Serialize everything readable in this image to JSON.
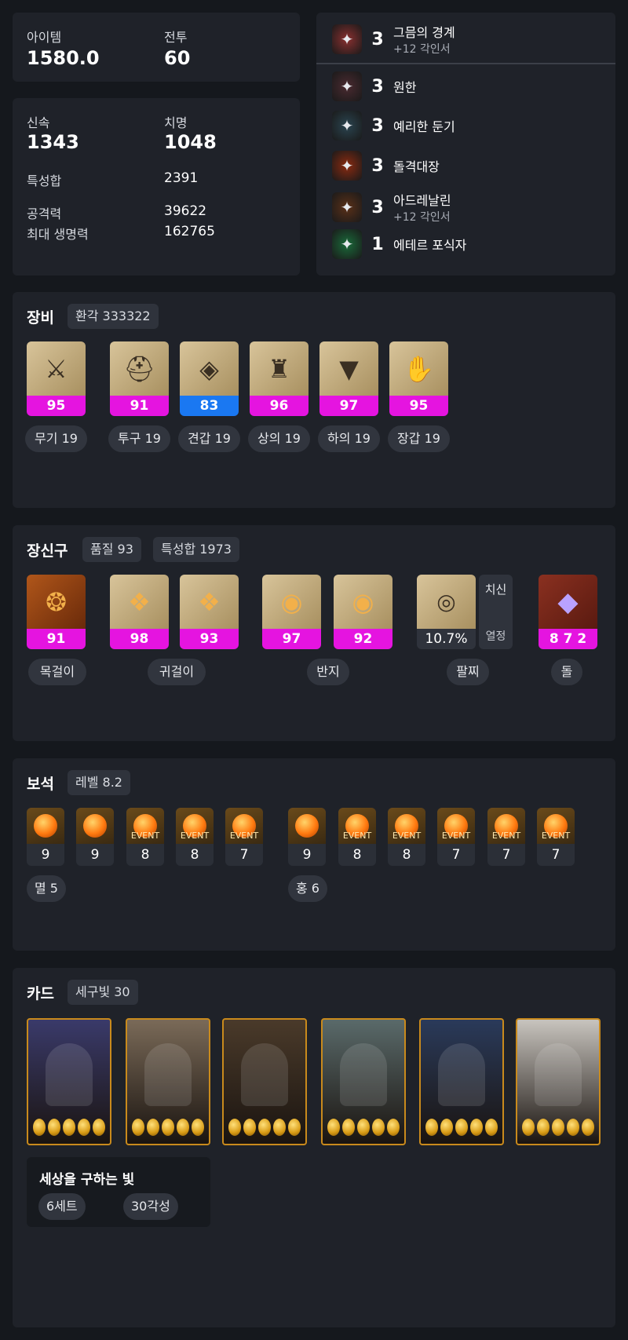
{
  "top_stats": {
    "item_label": "아이템",
    "item_value": "1580.0",
    "combat_label": "전투",
    "combat_value": "60"
  },
  "stats": {
    "swift_label": "신속",
    "swift_value": "1343",
    "crit_label": "치명",
    "crit_value": "1048",
    "trait_sum_label": "특성합",
    "trait_sum_value": "2391",
    "attack_label": "공격력",
    "attack_value": "39622",
    "maxhp_label": "최대 생명력",
    "maxhp_value": "162765"
  },
  "engravings": [
    {
      "level": "3",
      "name": "그믐의 경계",
      "sub": "+12 각인서",
      "icon": "dark-scythe-icon",
      "color": "#8a3030"
    },
    {
      "level": "3",
      "name": "원한",
      "sub": "",
      "icon": "grudge-beast-icon",
      "color": "#4a2a30"
    },
    {
      "level": "3",
      "name": "예리한 둔기",
      "sub": "",
      "icon": "keen-blunt-icon",
      "color": "#2a4450"
    },
    {
      "level": "3",
      "name": "돌격대장",
      "sub": "",
      "icon": "raid-captain-icon",
      "color": "#8a2a10"
    },
    {
      "level": "3",
      "name": "아드레날린",
      "sub": "+12 각인서",
      "icon": "adrenaline-icon",
      "color": "#5a3018"
    },
    {
      "level": "1",
      "name": "에테르 포식자",
      "sub": "",
      "icon": "ether-predator-icon",
      "color": "#1a6a3a"
    }
  ],
  "equipment": {
    "title": "장비",
    "badge": "환각 333322",
    "items": [
      {
        "quality": "95",
        "label": "무기 19",
        "icon": "weapon-icon",
        "glyph": "⚔",
        "tier": "pink"
      },
      {
        "quality": "91",
        "label": "투구 19",
        "icon": "helmet-icon",
        "glyph": "⛑",
        "tier": "pink"
      },
      {
        "quality": "83",
        "label": "견갑 19",
        "icon": "shoulder-icon",
        "glyph": "◈",
        "tier": "blue"
      },
      {
        "quality": "96",
        "label": "상의 19",
        "icon": "chest-armor-icon",
        "glyph": "♜",
        "tier": "pink"
      },
      {
        "quality": "97",
        "label": "하의 19",
        "icon": "pants-icon",
        "glyph": "▼",
        "tier": "pink"
      },
      {
        "quality": "95",
        "label": "장갑 19",
        "icon": "gloves-icon",
        "glyph": "✋",
        "tier": "pink"
      }
    ]
  },
  "accessories": {
    "title": "장신구",
    "badge_quality": "품질 93",
    "badge_trait": "특성합 1973",
    "items": [
      {
        "quality": "91",
        "icon": "necklace-icon"
      },
      {
        "quality": "98",
        "icon": "earring-icon"
      },
      {
        "quality": "93",
        "icon": "earring-icon"
      },
      {
        "quality": "97",
        "icon": "ring-icon"
      },
      {
        "quality": "92",
        "icon": "ring-icon"
      }
    ],
    "bracelet": {
      "value": "10.7%",
      "stat1": "치신",
      "stat2": "열정"
    },
    "stone": {
      "value": "8 7 2"
    },
    "labels": {
      "necklace": "목걸이",
      "earring": "귀걸이",
      "ring": "반지",
      "bracelet": "팔찌",
      "stone": "돌"
    }
  },
  "gems": {
    "title": "보석",
    "badge": "레벨 8.2",
    "left_group": {
      "label": "멸 5",
      "items": [
        {
          "level": "9",
          "event": ""
        },
        {
          "level": "9",
          "event": ""
        },
        {
          "level": "8",
          "event": "EVENT"
        },
        {
          "level": "8",
          "event": "EVENT"
        },
        {
          "level": "7",
          "event": "EVENT"
        }
      ]
    },
    "right_group": {
      "label": "홍 6",
      "items": [
        {
          "level": "9",
          "event": ""
        },
        {
          "level": "8",
          "event": "EVENT"
        },
        {
          "level": "8",
          "event": "EVENT"
        },
        {
          "level": "7",
          "event": "EVENT"
        },
        {
          "level": "7",
          "event": "EVENT"
        },
        {
          "level": "7",
          "event": "EVENT"
        }
      ]
    }
  },
  "cards": {
    "title": "카드",
    "badge": "세구빛 30",
    "items": [
      {
        "icon": "card-twin-demons-icon",
        "bg": "#3a3a6a",
        "awaken": 5
      },
      {
        "icon": "card-knight-icon",
        "bg": "#7a6a58",
        "awaken": 5
      },
      {
        "icon": "card-warlord-icon",
        "bg": "#4a3a2a",
        "awaken": 5
      },
      {
        "icon": "card-elder-icon",
        "bg": "#5a6a6a",
        "awaken": 5
      },
      {
        "icon": "card-wanderer-icon",
        "bg": "#2a3a5a",
        "awaken": 5
      },
      {
        "icon": "card-angel-icon",
        "bg": "#c8c4be",
        "awaken": 5
      }
    ],
    "set": {
      "name": "세상을 구하는 빛",
      "set_count": "6세트",
      "awaken_total": "30각성"
    }
  }
}
